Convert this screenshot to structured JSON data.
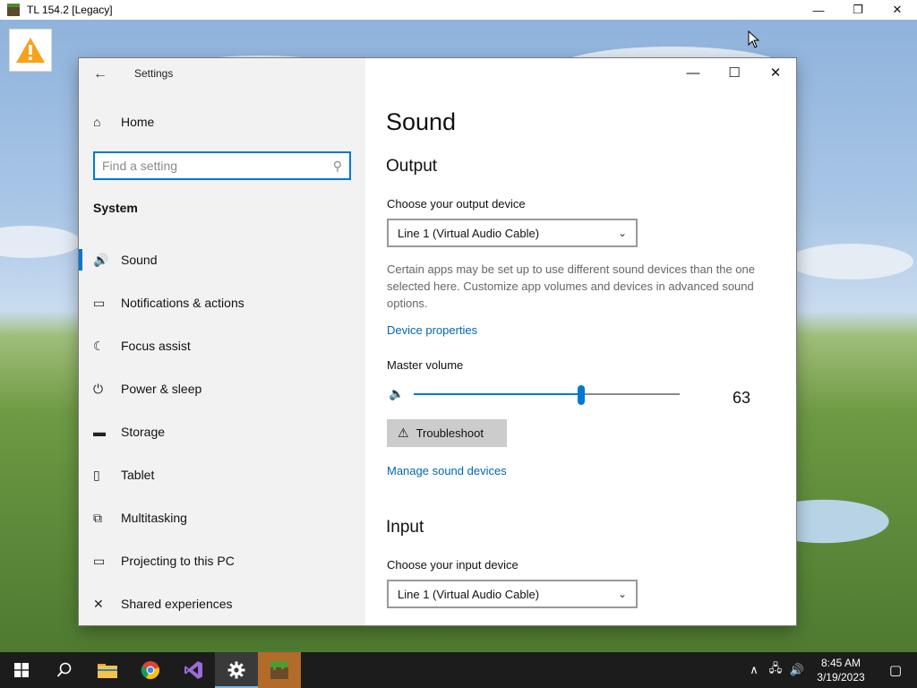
{
  "outer_window": {
    "title": "TL 154.2 [Legacy]",
    "minimize": "—",
    "restore": "❐",
    "close": "✕"
  },
  "settings": {
    "app_title": "Settings",
    "back_icon": "←",
    "home_label": "Home",
    "home_icon": "⌂",
    "search_placeholder": "Find a setting",
    "search_icon": "⚲",
    "section_title": "System",
    "nav_items": [
      {
        "label": "Sound",
        "icon": "🔊"
      },
      {
        "label": "Notifications & actions",
        "icon": "▭"
      },
      {
        "label": "Focus assist",
        "icon": "☾"
      },
      {
        "label": "Power & sleep",
        "icon": "⏻"
      },
      {
        "label": "Storage",
        "icon": "▬"
      },
      {
        "label": "Tablet",
        "icon": "▯"
      },
      {
        "label": "Multitasking",
        "icon": "⧉"
      },
      {
        "label": "Projecting to this PC",
        "icon": "▭"
      },
      {
        "label": "Shared experiences",
        "icon": "✕"
      }
    ],
    "window_controls": {
      "minimize": "—",
      "maximize": "☐",
      "close": "✕"
    }
  },
  "main": {
    "page_title": "Sound",
    "output_heading": "Output",
    "output_device_label": "Choose your output device",
    "output_device_value": "Line 1 (Virtual Audio Cable)",
    "description": "Certain apps may be set up to use different sound devices than the one selected here. Customize app volumes and devices in advanced sound options.",
    "device_properties_link": "Device properties",
    "master_volume_label": "Master volume",
    "volume_icon": "🔈",
    "master_volume_value": 63,
    "volume_display": "63",
    "troubleshoot_icon": "⚠",
    "troubleshoot_label": "Troubleshoot",
    "manage_link": "Manage sound devices",
    "input_heading": "Input",
    "input_device_label": "Choose your input device",
    "input_device_value": "Line 1 (Virtual Audio Cable)",
    "chevron_icon": "⌄"
  },
  "taskbar": {
    "start_icon": "⊞",
    "search_icon": "⚲",
    "clock_time": "8:45 AM",
    "clock_date": "3/19/2023",
    "tray_up_icon": "∧",
    "network_icon": "🖧",
    "speaker_icon": "🔊",
    "notification_icon": "▢"
  },
  "colors": {
    "accent": "#0078d4",
    "link": "#0067b8",
    "warning": "#f7a21b"
  }
}
